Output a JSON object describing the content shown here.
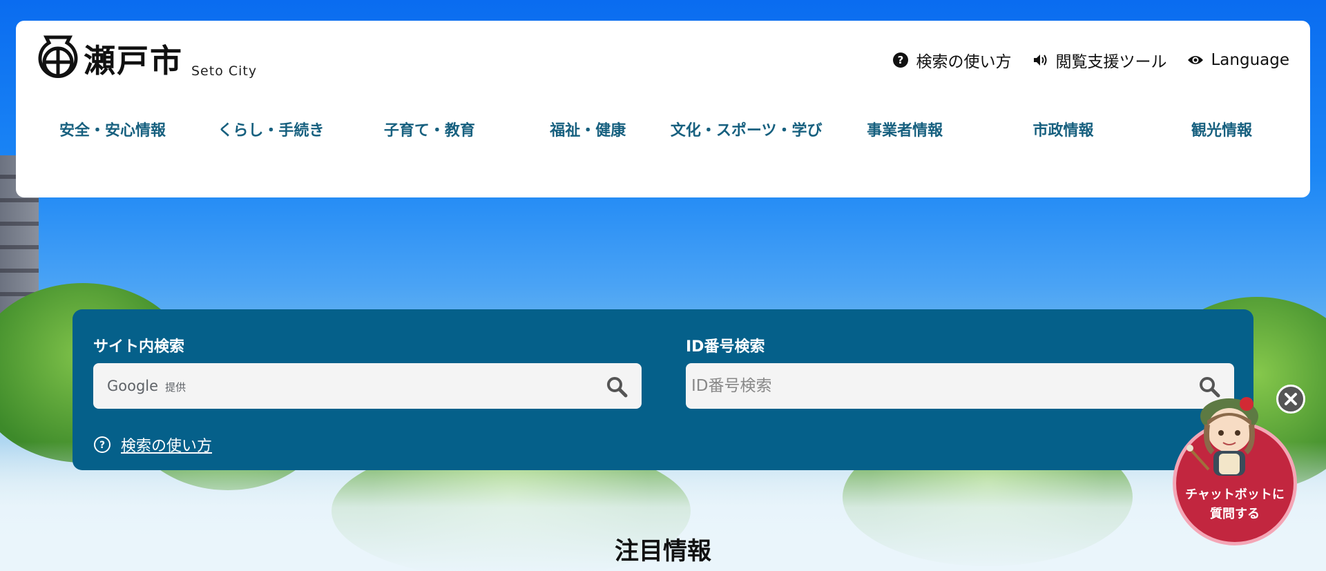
{
  "header": {
    "logo_text": "瀬戸市",
    "logo_sub": "Seto City",
    "utility": [
      {
        "label": "検索の使い方",
        "icon": "question-circle-icon"
      },
      {
        "label": "閲覧支援ツール",
        "icon": "speaker-icon"
      },
      {
        "label": "Language",
        "icon": "eye-icon"
      }
    ]
  },
  "gnav": [
    {
      "label": "安全・安心情報"
    },
    {
      "label": "くらし・手続き"
    },
    {
      "label": "子育て・教育"
    },
    {
      "label": "福祉・健康"
    },
    {
      "label": "文化・スポーツ・学び"
    },
    {
      "label": "事業者情報"
    },
    {
      "label": "市政情報"
    },
    {
      "label": "観光情報"
    }
  ],
  "search": {
    "site_label": "サイト内検索",
    "google_text": "Google",
    "google_provided": "提供",
    "id_label": "ID番号検索",
    "id_placeholder": "ID番号検索",
    "help_link": "検索の使い方"
  },
  "featured": {
    "title": "注目情報"
  },
  "chatbot": {
    "label_line1": "チャットボットに",
    "label_line2": "質問する"
  },
  "colors": {
    "nav_text": "#17607f",
    "search_panel": "#05608a",
    "chatbot_circle": "#c2263f"
  }
}
